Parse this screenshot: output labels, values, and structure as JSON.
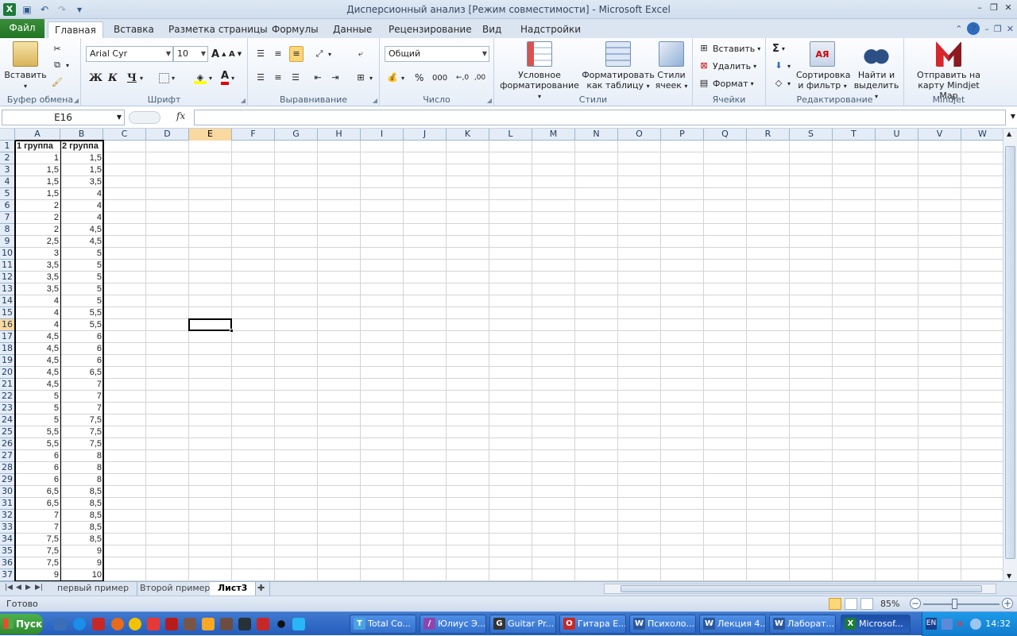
{
  "window": {
    "title": "Дисперсионный анализ  [Режим совместимости]  -  Microsoft Excel",
    "app_icon": "X"
  },
  "ribbon_tabs": [
    "Файл",
    "Главная",
    "Вставка",
    "Разметка страницы",
    "Формулы",
    "Данные",
    "Рецензирование",
    "Вид",
    "Надстройки"
  ],
  "ribbon": {
    "clipboard": {
      "paste": "Вставить",
      "group": "Буфер обмена"
    },
    "font": {
      "name": "Arial Cyr",
      "size": "10",
      "bold": "Ж",
      "italic": "К",
      "underline": "Ч",
      "group": "Шрифт",
      "grow": "A",
      "shrink": "A",
      "color_letter": "A"
    },
    "alignment": {
      "group": "Выравнивание"
    },
    "number": {
      "format": "Общий",
      "percent": "%",
      "thousands": "000",
      "group": "Число"
    },
    "styles": {
      "conditional": "Условное форматирование",
      "format_table": "Форматировать как таблицу",
      "cell_styles": "Стили ячеек",
      "group": "Стили"
    },
    "cells": {
      "insert": "Вставить",
      "delete": "Удалить",
      "format": "Формат",
      "group": "Ячейки"
    },
    "editing": {
      "sigma": "Σ",
      "sort": "Сортировка и фильтр",
      "find": "Найти и выделить",
      "group": "Редактирование"
    },
    "mindjet": {
      "send": "Отправить на карту Mindjet Map",
      "group": "Mindjet"
    }
  },
  "formula_bar": {
    "name_box": "E16",
    "fx": "fx",
    "value": ""
  },
  "grid": {
    "columns": [
      "A",
      "B",
      "C",
      "D",
      "E",
      "F",
      "G",
      "H",
      "I",
      "J",
      "K",
      "L",
      "M",
      "N",
      "O",
      "P",
      "Q",
      "R",
      "S",
      "T",
      "U",
      "V",
      "W"
    ],
    "selected_column": "E",
    "selected_row": "16",
    "rows": [
      "1",
      "2",
      "3",
      "4",
      "5",
      "6",
      "7",
      "8",
      "9",
      "10",
      "11",
      "12",
      "13",
      "14",
      "15",
      "16",
      "17",
      "18",
      "19",
      "20",
      "21",
      "22",
      "23",
      "24",
      "25",
      "26",
      "27",
      "28",
      "29",
      "30",
      "31",
      "32",
      "33",
      "34",
      "35",
      "36",
      "37"
    ],
    "header_A": "1 группа",
    "header_B": "2 группа",
    "col_A": [
      "1",
      "1,5",
      "1,5",
      "1,5",
      "2",
      "2",
      "2",
      "2,5",
      "3",
      "3,5",
      "3,5",
      "3,5",
      "4",
      "4",
      "4",
      "4,5",
      "4,5",
      "4,5",
      "4,5",
      "4,5",
      "5",
      "5",
      "5",
      "5,5",
      "5,5",
      "6",
      "6",
      "6",
      "6,5",
      "6,5",
      "7",
      "7",
      "7,5",
      "7,5",
      "7,5",
      "9"
    ],
    "col_B": [
      "1,5",
      "1,5",
      "3,5",
      "4",
      "4",
      "4",
      "4,5",
      "4,5",
      "5",
      "5",
      "5",
      "5",
      "5",
      "5,5",
      "5,5",
      "6",
      "6",
      "6",
      "6,5",
      "7",
      "7",
      "7",
      "7,5",
      "7,5",
      "7,5",
      "8",
      "8",
      "8",
      "8,5",
      "8,5",
      "8,5",
      "8,5",
      "8,5",
      "9",
      "9",
      "10"
    ]
  },
  "sheets": [
    "первый пример",
    "Второй пример",
    "Лист3"
  ],
  "active_sheet": "Лист3",
  "status": {
    "ready": "Готово",
    "zoom": "85%"
  },
  "taskbar": {
    "start": "Пуск",
    "tasks": [
      "Total Co...",
      "Юлиус Э...",
      "Guitar Pr...",
      "Гитара E...",
      "Психоло...",
      "Лекция 4...",
      "Лаборат...",
      "Microsof..."
    ],
    "lang": "EN",
    "clock": "14:32"
  }
}
